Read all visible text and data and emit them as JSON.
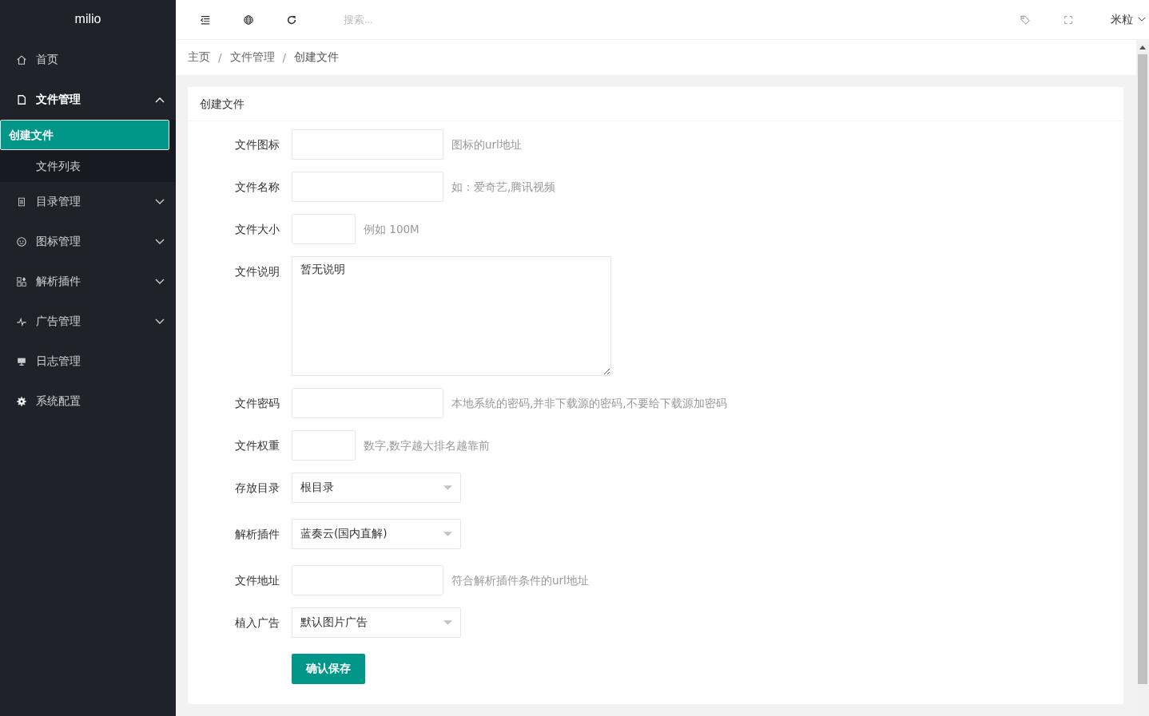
{
  "sidebar": {
    "logo": "milio",
    "items": [
      {
        "label": "首页"
      },
      {
        "label": "文件管理",
        "expanded": true,
        "children": [
          {
            "label": "创建文件",
            "selected": true
          },
          {
            "label": "文件列表",
            "selected": false
          }
        ]
      },
      {
        "label": "目录管理",
        "expanded": false
      },
      {
        "label": "图标管理",
        "expanded": false
      },
      {
        "label": "解析插件",
        "expanded": false
      },
      {
        "label": "广告管理",
        "expanded": false
      },
      {
        "label": "日志管理"
      },
      {
        "label": "系统配置"
      }
    ]
  },
  "header": {
    "search": {
      "placeholder": "搜索..."
    },
    "user": "米粒"
  },
  "breadcrumb": {
    "separator": "/",
    "items": [
      "主页",
      "文件管理",
      "创建文件"
    ]
  },
  "card": {
    "title": "创建文件",
    "fields": [
      {
        "label": "文件图标",
        "kind": "text",
        "hint": "图标的url地址"
      },
      {
        "label": "文件名称",
        "kind": "text",
        "hint": "如：爱奇艺,腾讯视频"
      },
      {
        "label": "文件大小",
        "kind": "short",
        "hint": "例如 100M"
      },
      {
        "label": "文件说明",
        "kind": "textarea",
        "value": "暂无说明"
      },
      {
        "label": "文件密码",
        "kind": "text",
        "hint": "本地系统的密码,并非下载源的密码,不要给下载源加密码"
      },
      {
        "label": "文件权重",
        "kind": "short",
        "hint": "数字,数字越大排名越靠前"
      },
      {
        "label": "存放目录",
        "kind": "select",
        "value": "根目录"
      },
      {
        "label": "解析插件",
        "kind": "select",
        "value": "蓝奏云(国内直解)"
      },
      {
        "label": "文件地址",
        "kind": "text",
        "hint": "符合解析插件条件的url地址"
      },
      {
        "label": "植入广告",
        "kind": "select",
        "value": "默认图片广告"
      }
    ],
    "submit": "确认保存"
  }
}
